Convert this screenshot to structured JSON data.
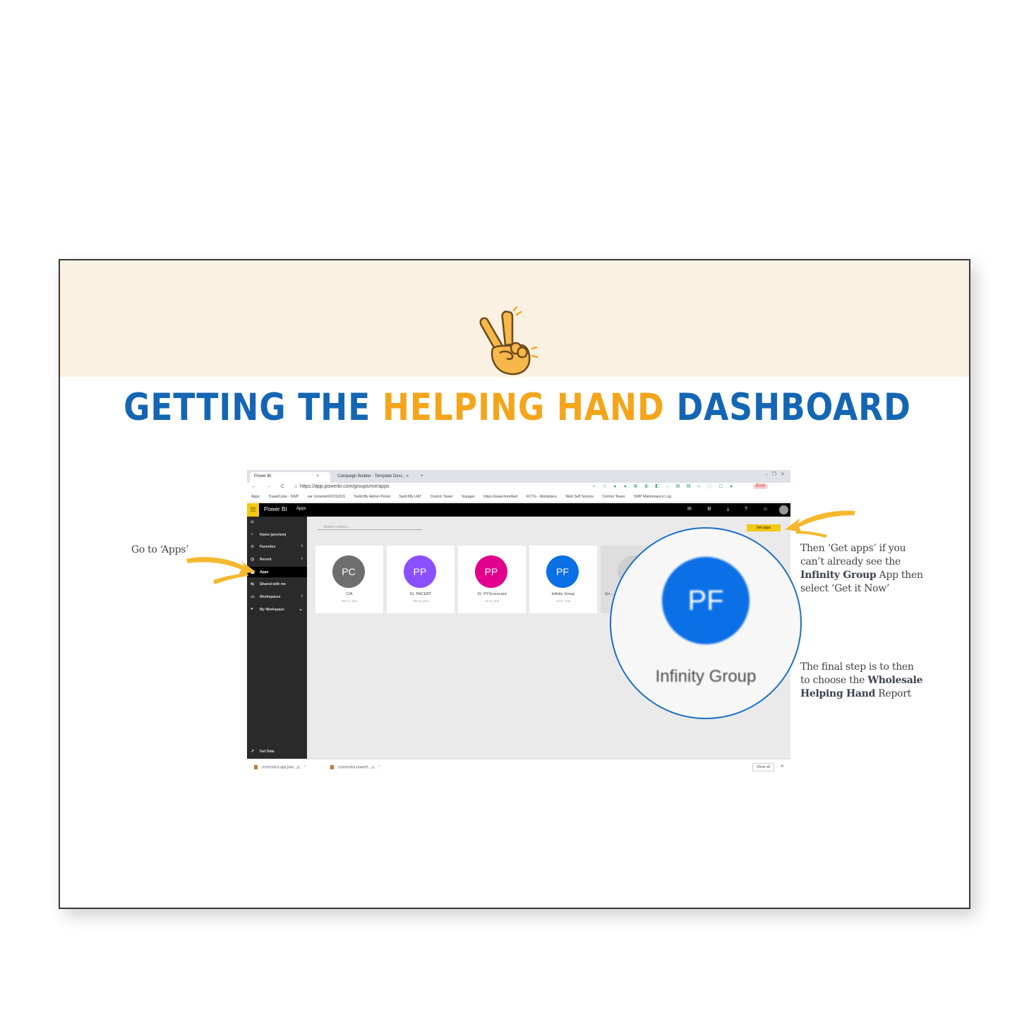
{
  "slide": {
    "title": {
      "part1": "GETTING THE ",
      "highlight": "HELPING HAND",
      "part2": " DASHBOARD"
    },
    "colors": {
      "banner": "#fbf1e2",
      "title_blue": "#1466b4",
      "title_orange": "#f5a51a",
      "arrow_yellow": "#f5b82e",
      "magnifier_ring": "#1a6fc2"
    },
    "icons": [
      "victory-hand-icon",
      "curved-arrow-icon"
    ]
  },
  "browser": {
    "tabs": [
      {
        "label": "Power BI",
        "close": "×"
      },
      {
        "label": "Campaign Builder - Template Desi...",
        "close": "×"
      }
    ],
    "new_tab": "+",
    "window_controls": "– ❐ ✕",
    "nav": "← → C ⌂",
    "url": "https://app.powerbi.com/groups/me/apps",
    "extensions": "⌕ ☆ ● ● ▣ ▣ ◧ ○ ▤ ▥ ⚲ ◇ ▢ ●",
    "error_chip": "Error",
    "bookmarks": [
      "Apps",
      "TravelCube - SWP",
      "var consoleFR1011815",
      "Switchfly Admin Portal",
      "Switchfly UAT",
      "Control Tower",
      "Voyager",
      "https://www.hotelbed",
      "FCTG - Workplace",
      "Web Self Service",
      "Control Tower",
      "SWP Maintenance Log"
    ]
  },
  "powerbi": {
    "brand": "Power BI",
    "breadcrumb": "Apps",
    "header_icons": "✉ ⚙ ⤓ ? ☺",
    "nav": [
      {
        "label": "Home (preview)",
        "icon": "⌂",
        "chevron": ""
      },
      {
        "label": "Favorites",
        "icon": "☆",
        "chevron": "›"
      },
      {
        "label": "Recent",
        "icon": "◷",
        "chevron": "›"
      },
      {
        "label": "Apps",
        "icon": "▦",
        "chevron": ""
      },
      {
        "label": "Shared with me",
        "icon": "⇆",
        "chevron": ""
      },
      {
        "label": "Workspaces",
        "icon": "▭",
        "chevron": "›"
      },
      {
        "label": "My Workspace",
        "icon": "●",
        "chevron": "⌄"
      }
    ],
    "get_data": "Get Data",
    "search_placeholder": "Search content...",
    "get_apps": "Get apps",
    "apps": [
      {
        "initials": "PC",
        "name": "CIA",
        "date": "SEP 17, 2018",
        "color": "#6e6e6e"
      },
      {
        "initials": "PP",
        "name": "IG: PACEBT",
        "date": "SEP 14, 2018",
        "color": "#8a4fff"
      },
      {
        "initials": "PP",
        "name": "IG: PYScorecard",
        "date": "OCT 5, 2018",
        "color": "#e3008c"
      },
      {
        "initials": "PF",
        "name": "Infinity Group",
        "date": "OCT 9, 2018",
        "color": "#0b6fe6"
      },
      {
        "initials": "",
        "name": "Ge...",
        "date": "",
        "color": "#cfcfcf"
      }
    ],
    "downloads": [
      "screenshot-app.pow....p...",
      "screenshot-powerb....p..."
    ],
    "show_all": "Show all",
    "close": "×"
  },
  "magnifier": {
    "initials": "PF",
    "label": "Infinity Group"
  },
  "annotations": {
    "go_to_apps": "Go to ‘Apps’",
    "get_apps": {
      "t1": "Then ‘Get apps’ if you can’t already see the ",
      "b1": "Infinity Group",
      "t2": " App then select ‘Get it Now’"
    },
    "final_step": {
      "t1": "The final step is to then to choose the ",
      "b1": "Wholesale Helping Hand",
      "t2": " Report"
    }
  }
}
